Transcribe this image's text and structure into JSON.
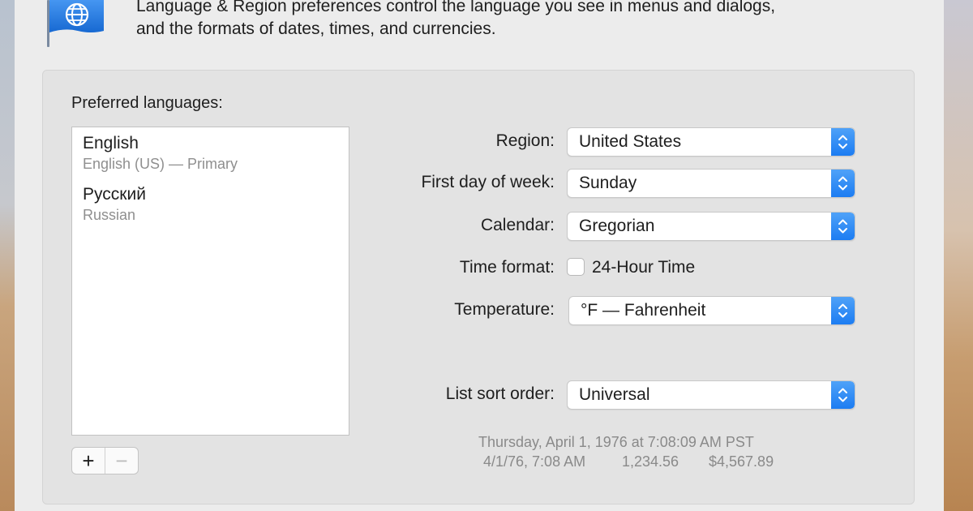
{
  "header": {
    "description_line1": "Language & Region preferences control the language you see in menus and dialogs,",
    "description_line2": "and the formats of dates, times, and currencies."
  },
  "languages": {
    "label": "Preferred languages:",
    "items": [
      {
        "name": "English",
        "subtitle": "English (US) — Primary"
      },
      {
        "name": "Русский",
        "subtitle": "Russian"
      }
    ],
    "add_label": "+",
    "remove_label": "−"
  },
  "settings": {
    "region": {
      "label": "Region:",
      "value": "United States"
    },
    "first_day": {
      "label": "First day of week:",
      "value": "Sunday"
    },
    "calendar": {
      "label": "Calendar:",
      "value": "Gregorian"
    },
    "time_format": {
      "label": "Time format:",
      "checkbox_label": "24-Hour Time",
      "checked": false
    },
    "temperature": {
      "label": "Temperature:",
      "value": "°F — Fahrenheit"
    },
    "sort_order": {
      "label": "List sort order:",
      "value": "Universal"
    }
  },
  "sample": {
    "datetime": "Thursday, April 1, 1976 at 7:08:09 AM PST",
    "short_date": "4/1/76, 7:08 AM",
    "number": "1,234.56",
    "currency": "$4,567.89"
  },
  "colors": {
    "accent": "#1c7cf2",
    "window_bg": "#ececec",
    "panel_bg": "#e3e3e3"
  },
  "icons": {
    "header": "globe-flag-icon",
    "popup": "updown-chevron-icon"
  }
}
